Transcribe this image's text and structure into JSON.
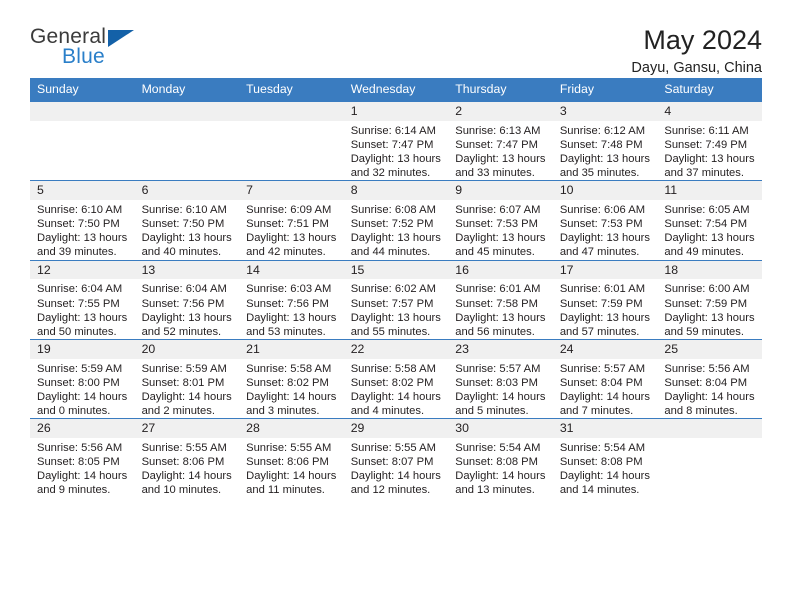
{
  "brand": {
    "name_top": "General",
    "name_bottom": "Blue",
    "triangle_color": "#1461a8",
    "blue_color": "#2a7fc9"
  },
  "header": {
    "title": "May 2024",
    "location": "Dayu, Gansu, China"
  },
  "theme": {
    "header_bg": "#3a7cc0",
    "header_text": "#ffffff",
    "daynum_bg": "#f0f0f0",
    "grid_line": "#3a7cc0",
    "body_text": "#231f20"
  },
  "weekdays": [
    "Sunday",
    "Monday",
    "Tuesday",
    "Wednesday",
    "Thursday",
    "Friday",
    "Saturday"
  ],
  "labels": {
    "sunrise": "Sunrise:",
    "sunset": "Sunset:",
    "daylight": "Daylight:"
  },
  "weeks": [
    [
      {
        "day": "",
        "empty": true
      },
      {
        "day": "",
        "empty": true
      },
      {
        "day": "",
        "empty": true
      },
      {
        "day": "1",
        "sunrise": "Sunrise: 6:14 AM",
        "sunset": "Sunset: 7:47 PM",
        "daylight": "Daylight: 13 hours and 32 minutes."
      },
      {
        "day": "2",
        "sunrise": "Sunrise: 6:13 AM",
        "sunset": "Sunset: 7:47 PM",
        "daylight": "Daylight: 13 hours and 33 minutes."
      },
      {
        "day": "3",
        "sunrise": "Sunrise: 6:12 AM",
        "sunset": "Sunset: 7:48 PM",
        "daylight": "Daylight: 13 hours and 35 minutes."
      },
      {
        "day": "4",
        "sunrise": "Sunrise: 6:11 AM",
        "sunset": "Sunset: 7:49 PM",
        "daylight": "Daylight: 13 hours and 37 minutes."
      }
    ],
    [
      {
        "day": "5",
        "sunrise": "Sunrise: 6:10 AM",
        "sunset": "Sunset: 7:50 PM",
        "daylight": "Daylight: 13 hours and 39 minutes."
      },
      {
        "day": "6",
        "sunrise": "Sunrise: 6:10 AM",
        "sunset": "Sunset: 7:50 PM",
        "daylight": "Daylight: 13 hours and 40 minutes."
      },
      {
        "day": "7",
        "sunrise": "Sunrise: 6:09 AM",
        "sunset": "Sunset: 7:51 PM",
        "daylight": "Daylight: 13 hours and 42 minutes."
      },
      {
        "day": "8",
        "sunrise": "Sunrise: 6:08 AM",
        "sunset": "Sunset: 7:52 PM",
        "daylight": "Daylight: 13 hours and 44 minutes."
      },
      {
        "day": "9",
        "sunrise": "Sunrise: 6:07 AM",
        "sunset": "Sunset: 7:53 PM",
        "daylight": "Daylight: 13 hours and 45 minutes."
      },
      {
        "day": "10",
        "sunrise": "Sunrise: 6:06 AM",
        "sunset": "Sunset: 7:53 PM",
        "daylight": "Daylight: 13 hours and 47 minutes."
      },
      {
        "day": "11",
        "sunrise": "Sunrise: 6:05 AM",
        "sunset": "Sunset: 7:54 PM",
        "daylight": "Daylight: 13 hours and 49 minutes."
      }
    ],
    [
      {
        "day": "12",
        "sunrise": "Sunrise: 6:04 AM",
        "sunset": "Sunset: 7:55 PM",
        "daylight": "Daylight: 13 hours and 50 minutes."
      },
      {
        "day": "13",
        "sunrise": "Sunrise: 6:04 AM",
        "sunset": "Sunset: 7:56 PM",
        "daylight": "Daylight: 13 hours and 52 minutes."
      },
      {
        "day": "14",
        "sunrise": "Sunrise: 6:03 AM",
        "sunset": "Sunset: 7:56 PM",
        "daylight": "Daylight: 13 hours and 53 minutes."
      },
      {
        "day": "15",
        "sunrise": "Sunrise: 6:02 AM",
        "sunset": "Sunset: 7:57 PM",
        "daylight": "Daylight: 13 hours and 55 minutes."
      },
      {
        "day": "16",
        "sunrise": "Sunrise: 6:01 AM",
        "sunset": "Sunset: 7:58 PM",
        "daylight": "Daylight: 13 hours and 56 minutes."
      },
      {
        "day": "17",
        "sunrise": "Sunrise: 6:01 AM",
        "sunset": "Sunset: 7:59 PM",
        "daylight": "Daylight: 13 hours and 57 minutes."
      },
      {
        "day": "18",
        "sunrise": "Sunrise: 6:00 AM",
        "sunset": "Sunset: 7:59 PM",
        "daylight": "Daylight: 13 hours and 59 minutes."
      }
    ],
    [
      {
        "day": "19",
        "sunrise": "Sunrise: 5:59 AM",
        "sunset": "Sunset: 8:00 PM",
        "daylight": "Daylight: 14 hours and 0 minutes."
      },
      {
        "day": "20",
        "sunrise": "Sunrise: 5:59 AM",
        "sunset": "Sunset: 8:01 PM",
        "daylight": "Daylight: 14 hours and 2 minutes."
      },
      {
        "day": "21",
        "sunrise": "Sunrise: 5:58 AM",
        "sunset": "Sunset: 8:02 PM",
        "daylight": "Daylight: 14 hours and 3 minutes."
      },
      {
        "day": "22",
        "sunrise": "Sunrise: 5:58 AM",
        "sunset": "Sunset: 8:02 PM",
        "daylight": "Daylight: 14 hours and 4 minutes."
      },
      {
        "day": "23",
        "sunrise": "Sunrise: 5:57 AM",
        "sunset": "Sunset: 8:03 PM",
        "daylight": "Daylight: 14 hours and 5 minutes."
      },
      {
        "day": "24",
        "sunrise": "Sunrise: 5:57 AM",
        "sunset": "Sunset: 8:04 PM",
        "daylight": "Daylight: 14 hours and 7 minutes."
      },
      {
        "day": "25",
        "sunrise": "Sunrise: 5:56 AM",
        "sunset": "Sunset: 8:04 PM",
        "daylight": "Daylight: 14 hours and 8 minutes."
      }
    ],
    [
      {
        "day": "26",
        "sunrise": "Sunrise: 5:56 AM",
        "sunset": "Sunset: 8:05 PM",
        "daylight": "Daylight: 14 hours and 9 minutes."
      },
      {
        "day": "27",
        "sunrise": "Sunrise: 5:55 AM",
        "sunset": "Sunset: 8:06 PM",
        "daylight": "Daylight: 14 hours and 10 minutes."
      },
      {
        "day": "28",
        "sunrise": "Sunrise: 5:55 AM",
        "sunset": "Sunset: 8:06 PM",
        "daylight": "Daylight: 14 hours and 11 minutes."
      },
      {
        "day": "29",
        "sunrise": "Sunrise: 5:55 AM",
        "sunset": "Sunset: 8:07 PM",
        "daylight": "Daylight: 14 hours and 12 minutes."
      },
      {
        "day": "30",
        "sunrise": "Sunrise: 5:54 AM",
        "sunset": "Sunset: 8:08 PM",
        "daylight": "Daylight: 14 hours and 13 minutes."
      },
      {
        "day": "31",
        "sunrise": "Sunrise: 5:54 AM",
        "sunset": "Sunset: 8:08 PM",
        "daylight": "Daylight: 14 hours and 14 minutes."
      },
      {
        "day": "",
        "empty": true
      }
    ]
  ]
}
